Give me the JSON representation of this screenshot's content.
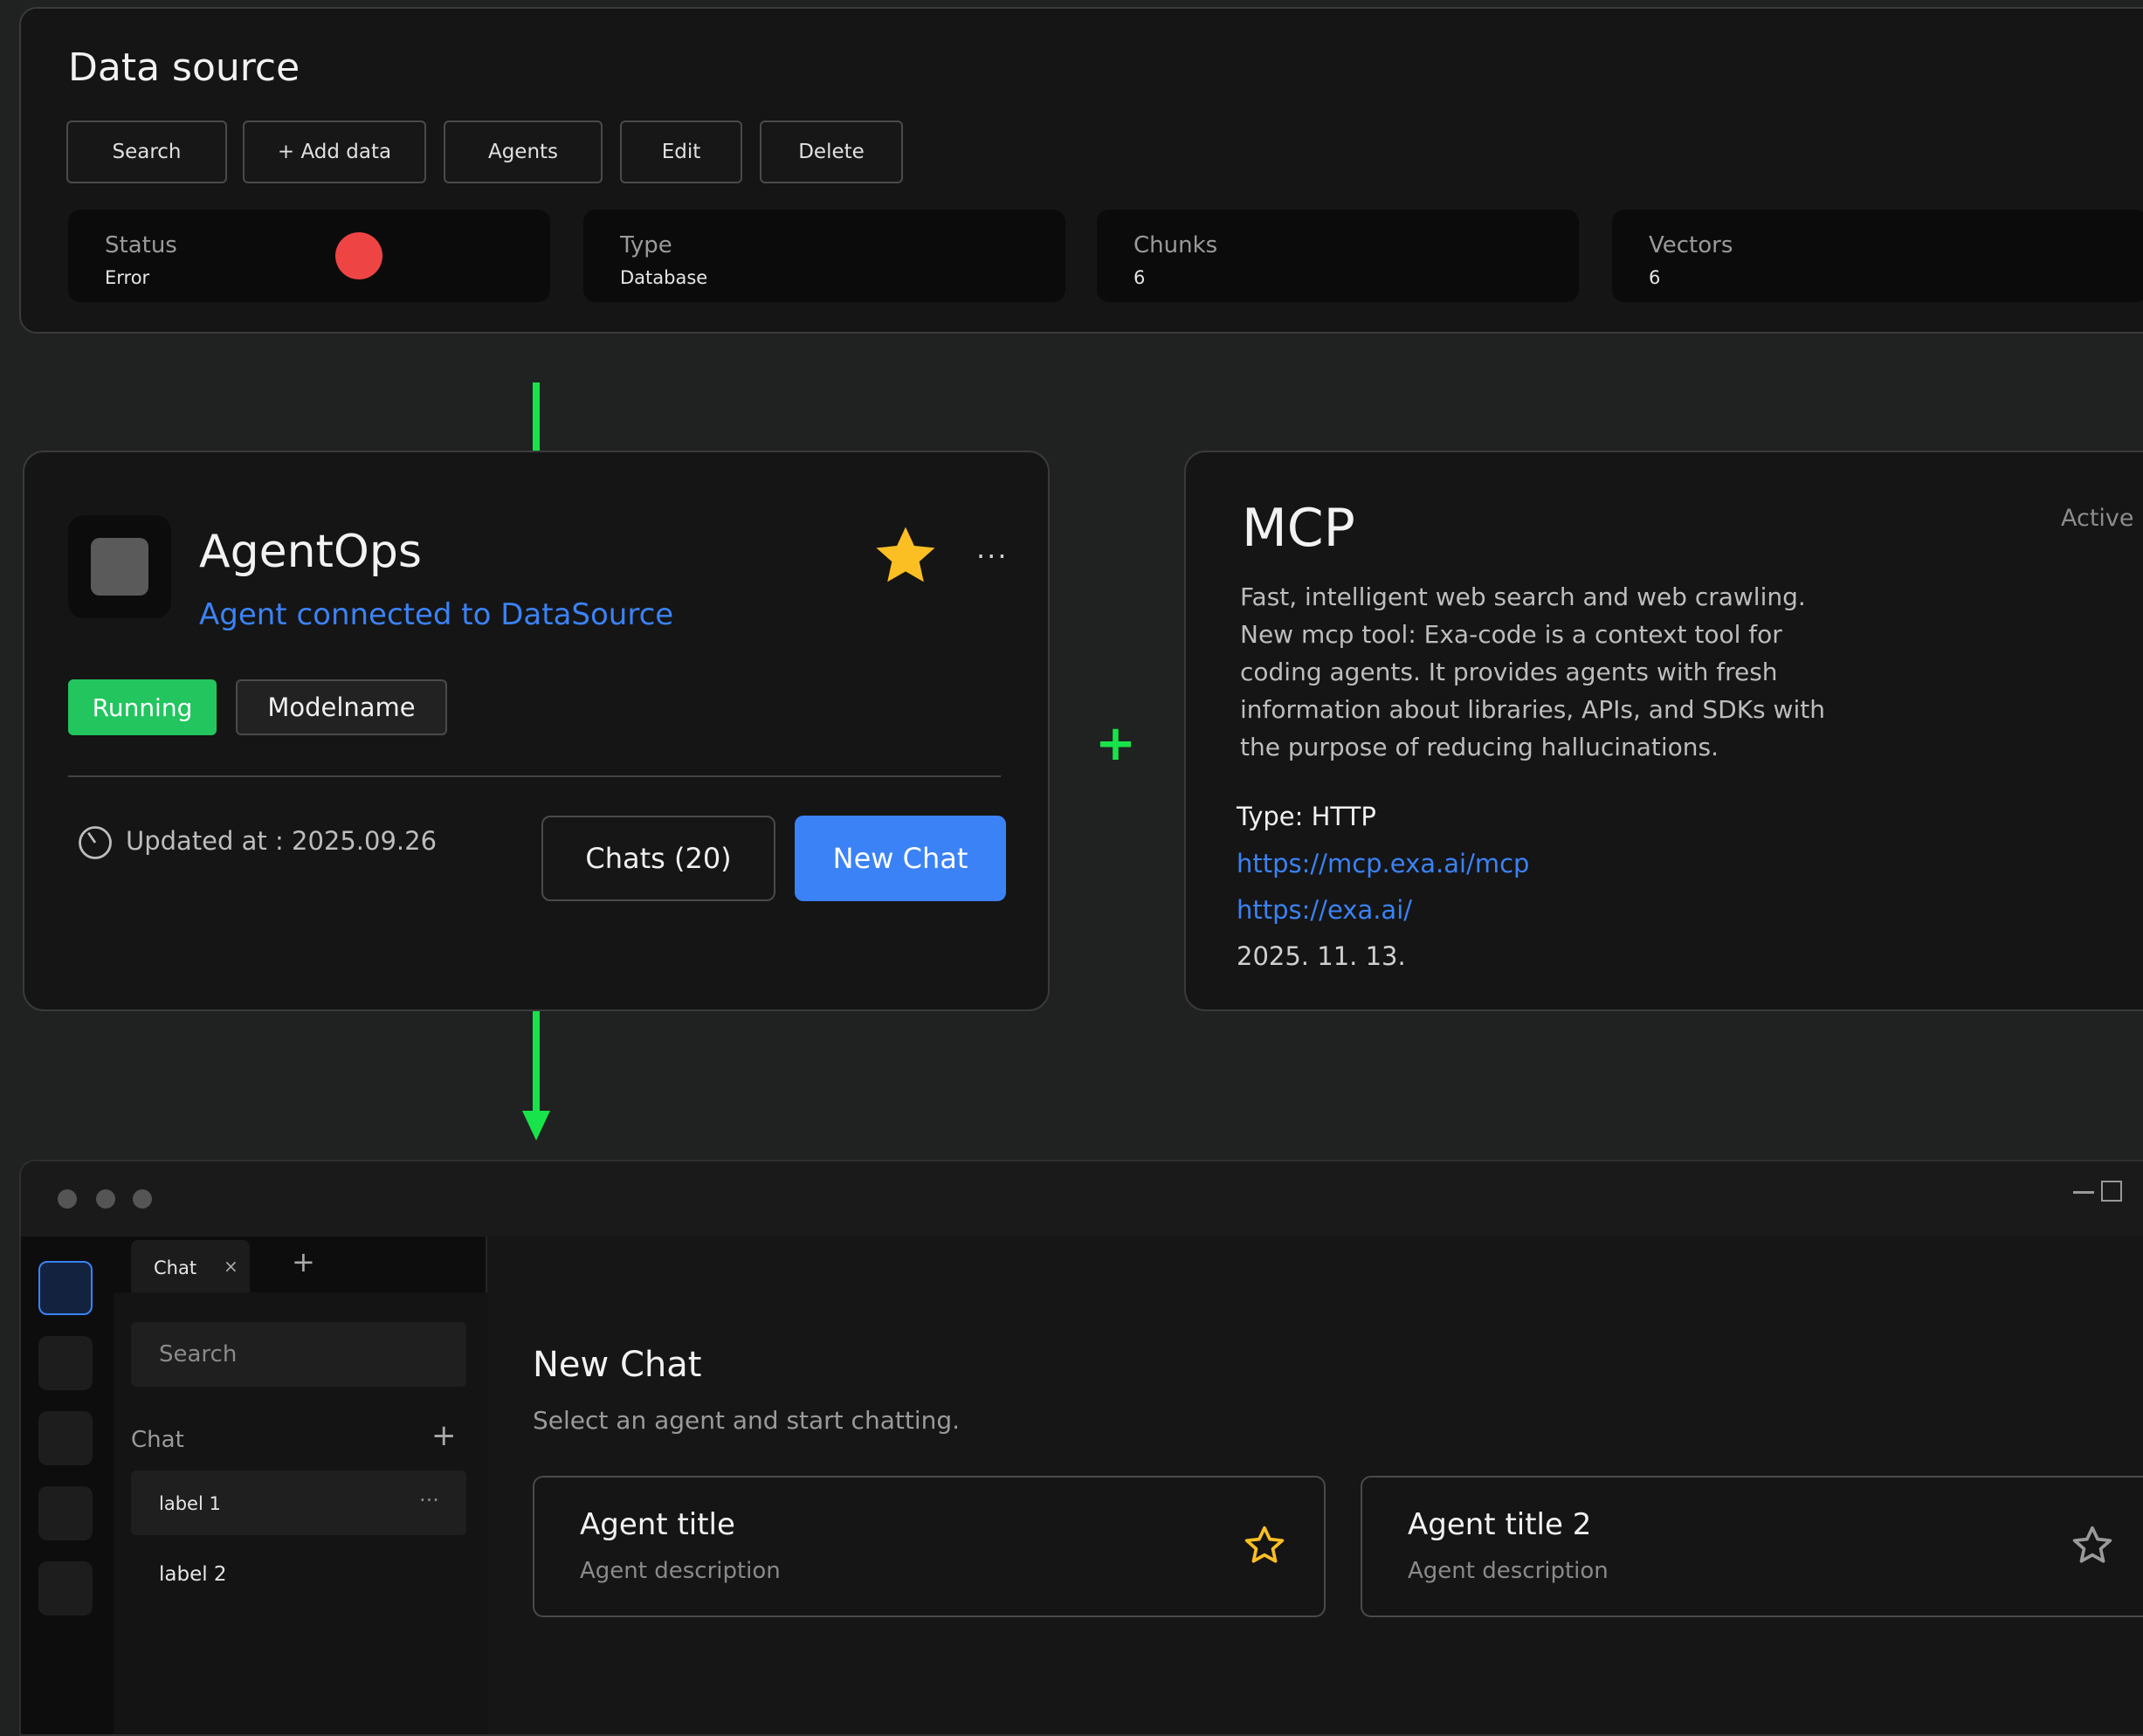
{
  "data_source": {
    "title": "Data source",
    "buttons": [
      "Search",
      "+ Add data",
      "Agents",
      "Edit",
      "Delete"
    ],
    "stats": [
      {
        "label": "Status",
        "value": "Error"
      },
      {
        "label": "Type",
        "value": "Database"
      },
      {
        "label": "Chunks",
        "value": "6"
      },
      {
        "label": "Vectors",
        "value": "6"
      }
    ],
    "status_color": "#ef4444"
  },
  "agent_card": {
    "title": "AgentOps",
    "subtitle": "Agent connected to DataSource",
    "status_badge": "Running",
    "model_badge": "Modelname",
    "updated": "Updated at : 2025.09.26",
    "chats_button": "Chats (20)",
    "new_chat_button": "New Chat",
    "more": "···"
  },
  "mcp_card": {
    "title": "MCP",
    "status": "Active",
    "description": "Fast, intelligent web search and web crawling. New mcp tool: Exa-code is a context tool for coding agents. It provides agents with fresh information about libraries, APIs, and SDKs with the purpose of reducing hallucinations.",
    "type": "Type: HTTP",
    "link1": "https://mcp.exa.ai/mcp",
    "link2": "https://exa.ai/",
    "date": "2025. 11. 13."
  },
  "connector_plus": "+",
  "app_window": {
    "tab_label": "Chat",
    "tab_close": "×",
    "tab_add": "+",
    "search_placeholder": "Search",
    "section_label": "Chat",
    "section_add": "+",
    "list_items": [
      "label 1",
      "label 2"
    ],
    "list_more": "···",
    "main_title": "New Chat",
    "main_subtitle": "Select an agent and start chatting.",
    "agents": [
      {
        "title": "Agent title",
        "description": "Agent description",
        "favorite": true
      },
      {
        "title": "Agent title 2",
        "description": "Agent description",
        "favorite": false
      }
    ]
  },
  "colors": {
    "accent_blue": "#3b82f6",
    "running_green": "#22c55e",
    "connector_green": "#19e34a",
    "star_yellow": "#fbbf24"
  }
}
